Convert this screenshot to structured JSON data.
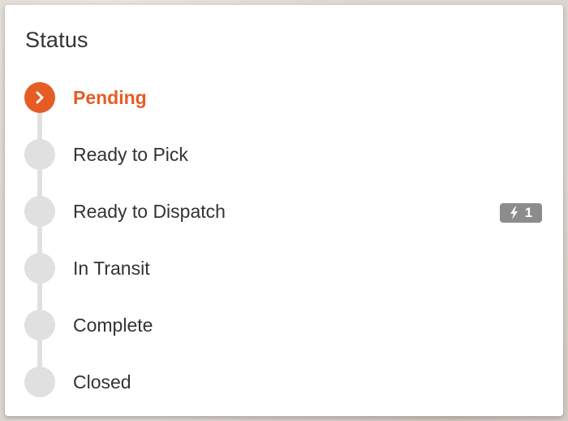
{
  "panel": {
    "title": "Status"
  },
  "steps": [
    {
      "label": "Pending",
      "state": "active",
      "icon": "chevron-right-icon"
    },
    {
      "label": "Ready to Pick",
      "state": "inactive"
    },
    {
      "label": "Ready to Dispatch",
      "state": "inactive",
      "badge": {
        "icon": "lightning-bolt-icon",
        "count": "1"
      }
    },
    {
      "label": "In Transit",
      "state": "inactive"
    },
    {
      "label": "Complete",
      "state": "inactive"
    },
    {
      "label": "Closed",
      "state": "inactive"
    }
  ],
  "colors": {
    "accent": "#e65c25",
    "inactive_dot": "#e0e0e0",
    "badge_bg": "#8c8c8c",
    "text": "#333333"
  }
}
